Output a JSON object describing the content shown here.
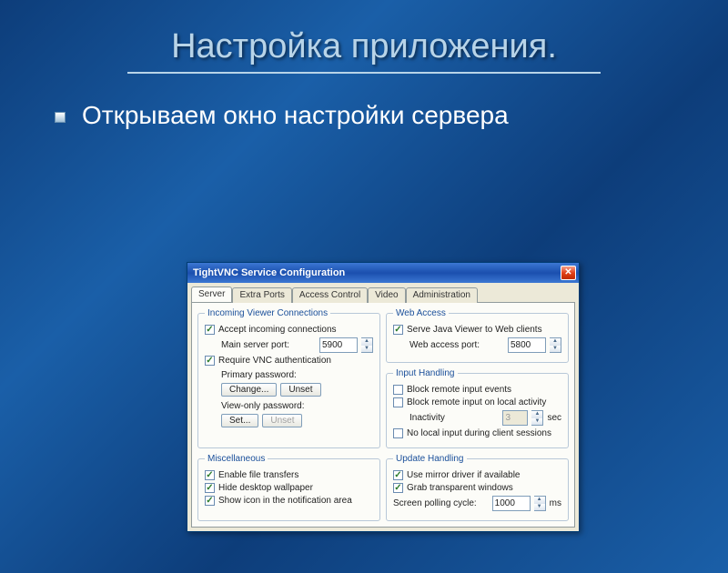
{
  "slide": {
    "title": "Настройка приложения.",
    "bullet": "Открываем окно настройки сервера"
  },
  "dialog": {
    "title": "TightVNC Service Configuration",
    "tabs": [
      "Server",
      "Extra Ports",
      "Access Control",
      "Video",
      "Administration"
    ],
    "groups": {
      "incoming": {
        "legend": "Incoming Viewer Connections",
        "accept": "Accept incoming connections",
        "main_port_label": "Main server port:",
        "main_port": "5900",
        "require_auth": "Require VNC authentication",
        "primary_pw_label": "Primary password:",
        "change": "Change...",
        "unset": "Unset",
        "viewonly_pw_label": "View-only password:",
        "set": "Set..."
      },
      "web": {
        "legend": "Web Access",
        "serve": "Serve Java Viewer to Web clients",
        "port_label": "Web access port:",
        "port": "5800"
      },
      "input": {
        "legend": "Input Handling",
        "block_remote": "Block remote input events",
        "block_local": "Block remote input on local activity",
        "inactivity_label": "Inactivity",
        "inactivity": "3",
        "sec": "sec",
        "no_local": "No local input during client sessions"
      },
      "misc": {
        "legend": "Miscellaneous",
        "transfers": "Enable file transfers",
        "wallpaper": "Hide desktop wallpaper",
        "icon": "Show icon in the notification area"
      },
      "update": {
        "legend": "Update Handling",
        "mirror": "Use mirror driver if available",
        "grab": "Grab transparent windows",
        "polling_label": "Screen polling cycle:",
        "polling": "1000",
        "ms": "ms"
      }
    }
  }
}
